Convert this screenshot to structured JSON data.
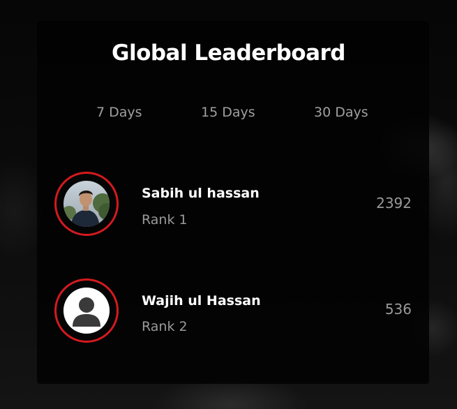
{
  "header": {
    "title": "Global Leaderboard"
  },
  "tabs": [
    {
      "label": "7 Days"
    },
    {
      "label": "15 Days"
    },
    {
      "label": "30 Days"
    }
  ],
  "entries": [
    {
      "name": "Sabih ul hassan",
      "rank": "Rank 1",
      "score": "2392",
      "avatar": "user-photo"
    },
    {
      "name": "Wajih ul Hassan",
      "rank": "Rank 2",
      "score": "536",
      "avatar": "default-user-icon"
    }
  ],
  "colors": {
    "accent_ring": "#d41a1f",
    "background": "#050505",
    "text_primary": "#ffffff",
    "text_secondary": "#9a9a9a"
  }
}
